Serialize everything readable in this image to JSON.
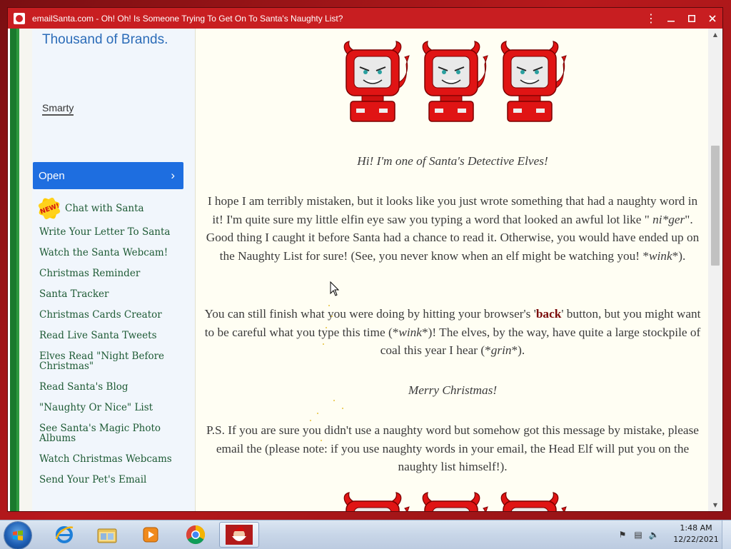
{
  "window": {
    "title": "emailSanta.com - Oh! Oh! Is Someone Trying To Get On To Santa's Naughty List?"
  },
  "sidebar": {
    "brand_tail": "Thousand of Brands.",
    "smarty_link": "Smarty",
    "open_button": "Open",
    "new_badge": "NEW!",
    "items": [
      {
        "label": "Chat with Santa"
      },
      {
        "label": "Write Your Letter To Santa"
      },
      {
        "label": "Watch the Santa Webcam!"
      },
      {
        "label": "Christmas Reminder"
      },
      {
        "label": "Santa Tracker"
      },
      {
        "label": "Christmas Cards Creator"
      },
      {
        "label": "Read Live Santa Tweets"
      },
      {
        "label": "Elves Read \"Night Before Christmas\""
      },
      {
        "label": "Read Santa's Blog"
      },
      {
        "label": "\"Naughty Or Nice\" List"
      },
      {
        "label": "See Santa's Magic Photo Albums"
      },
      {
        "label": "Watch Christmas Webcams"
      },
      {
        "label": "Send Your Pet's Email"
      }
    ]
  },
  "main": {
    "greeting": "Hi!  I'm one of Santa's Detective Elves!",
    "p1_a": "I hope I am terribly mistaken, but it looks like you just wrote something that had a naughty word in it!  I'm quite sure my little elfin eye saw you typing a word that looked an awful lot like \"",
    "p1_word": " ni*ger",
    "p1_b": "\".  Good thing I caught it before Santa had a chance to read it.  Otherwise, you would have ended up on the Naughty List for sure!  (See, you never know when an elf might be watching you! *",
    "p1_wink": "wink",
    "p1_c": "*).",
    "p2_a": "You can still finish what you were doing by hitting your browser's '",
    "p2_back": "back",
    "p2_b": "' button, but you might want to be careful what you type this time (*",
    "p2_wink": "wink",
    "p2_c": "*)!  The elves, by the way, have quite a large stockpile of coal this year I hear (*",
    "p2_grin": "grin",
    "p2_d": "*).",
    "merry": "Merry Christmas!",
    "ps": "P.S.  If you are sure you didn't use a naughty word but somehow got this message by mistake, please email the (please note: if you use naughty words in your email, the Head Elf will put you on the naughty list himself!)."
  },
  "taskbar": {
    "time": "1:48 AM",
    "date": "12/22/2021",
    "apps": [
      "Internet Explorer",
      "Windows Explorer",
      "Windows Media Player",
      "Google Chrome",
      "emailSanta"
    ]
  },
  "colors": {
    "titlebar": "#c81e21",
    "nav_text": "#1d5a34",
    "open_button": "#1e6ee0",
    "brand": "#2b6cb8"
  }
}
